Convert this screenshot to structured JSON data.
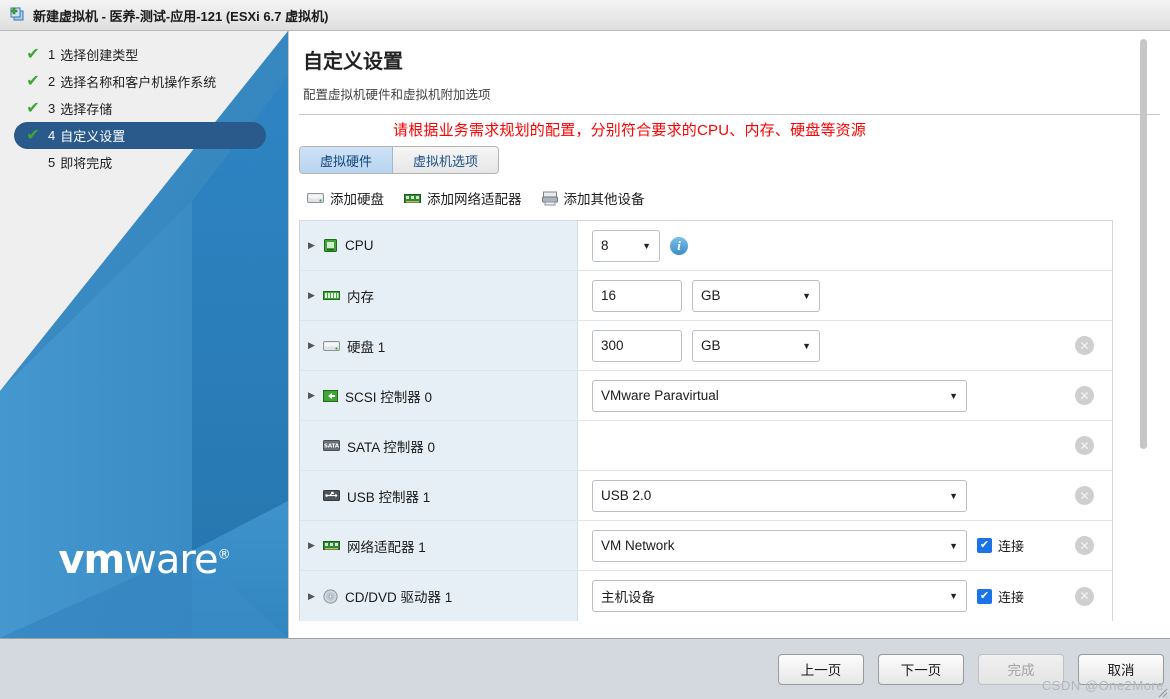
{
  "titlebar": {
    "icon": "new-vm-icon",
    "title": "新建虚拟机 - 医养-测试-应用-121 (ESXi 6.7 虚拟机)"
  },
  "sidebar": {
    "logo_vm": "vm",
    "logo_ware": "ware",
    "logo_reg": "®",
    "steps": [
      {
        "num": "1",
        "label": "选择创建类型",
        "done": true,
        "active": false
      },
      {
        "num": "2",
        "label": "选择名称和客户机操作系统",
        "done": true,
        "active": false
      },
      {
        "num": "3",
        "label": "选择存储",
        "done": true,
        "active": false
      },
      {
        "num": "4",
        "label": "自定义设置",
        "done": true,
        "active": true
      },
      {
        "num": "5",
        "label": "即将完成",
        "done": false,
        "active": false
      }
    ]
  },
  "content": {
    "title": "自定义设置",
    "subtitle": "配置虚拟机硬件和虚拟机附加选项",
    "warning_note": "请根据业务需求规划的配置，分别符合要求的CPU、内存、硬盘等资源",
    "warning_color": "#ff0000",
    "tabs": [
      {
        "label": "虚拟硬件",
        "active": true
      },
      {
        "label": "虚拟机选项",
        "active": false
      }
    ],
    "toolbar": [
      {
        "label": "添加硬盘",
        "icon": "hard-disk-icon"
      },
      {
        "label": "添加网络适配器",
        "icon": "network-adapter-icon"
      },
      {
        "label": "添加其他设备",
        "icon": "other-device-icon"
      }
    ],
    "hardware": [
      {
        "name": "CPU",
        "icon": "cpu-icon",
        "expandable": true,
        "control": "select",
        "value": "8",
        "info": true,
        "removable": false
      },
      {
        "name": "内存",
        "icon": "memory-icon",
        "expandable": true,
        "control": "input-unit",
        "value": "16",
        "unit": "GB",
        "removable": false
      },
      {
        "name": "硬盘 1",
        "icon": "hard-disk-icon",
        "expandable": true,
        "control": "input-unit",
        "value": "300",
        "unit": "GB",
        "removable": true
      },
      {
        "name": "SCSI 控制器 0",
        "icon": "scsi-controller-icon",
        "expandable": true,
        "control": "select-wide",
        "value": "VMware Paravirtual",
        "removable": true
      },
      {
        "name": "SATA 控制器 0",
        "icon": "sata-controller-icon",
        "expandable": false,
        "control": "none",
        "value": "",
        "removable": true
      },
      {
        "name": "USB 控制器 1",
        "icon": "usb-controller-icon",
        "expandable": false,
        "control": "select-wide",
        "value": "USB 2.0",
        "removable": true
      },
      {
        "name": "网络适配器 1",
        "icon": "network-adapter-icon",
        "expandable": true,
        "control": "select-wide",
        "value": "VM Network",
        "checkbox_label": "连接",
        "checked": true,
        "removable": true
      },
      {
        "name": "CD/DVD 驱动器 1",
        "icon": "cd-dvd-icon",
        "expandable": true,
        "control": "select-wide",
        "value": "主机设备",
        "checkbox_label": "连接",
        "checked": true,
        "removable": true
      }
    ]
  },
  "footer": {
    "buttons": [
      {
        "label": "上一页",
        "disabled": false
      },
      {
        "label": "下一页",
        "disabled": false
      },
      {
        "label": "完成",
        "disabled": true
      },
      {
        "label": "取消",
        "disabled": false
      }
    ],
    "watermark": "CSDN @One2More"
  }
}
